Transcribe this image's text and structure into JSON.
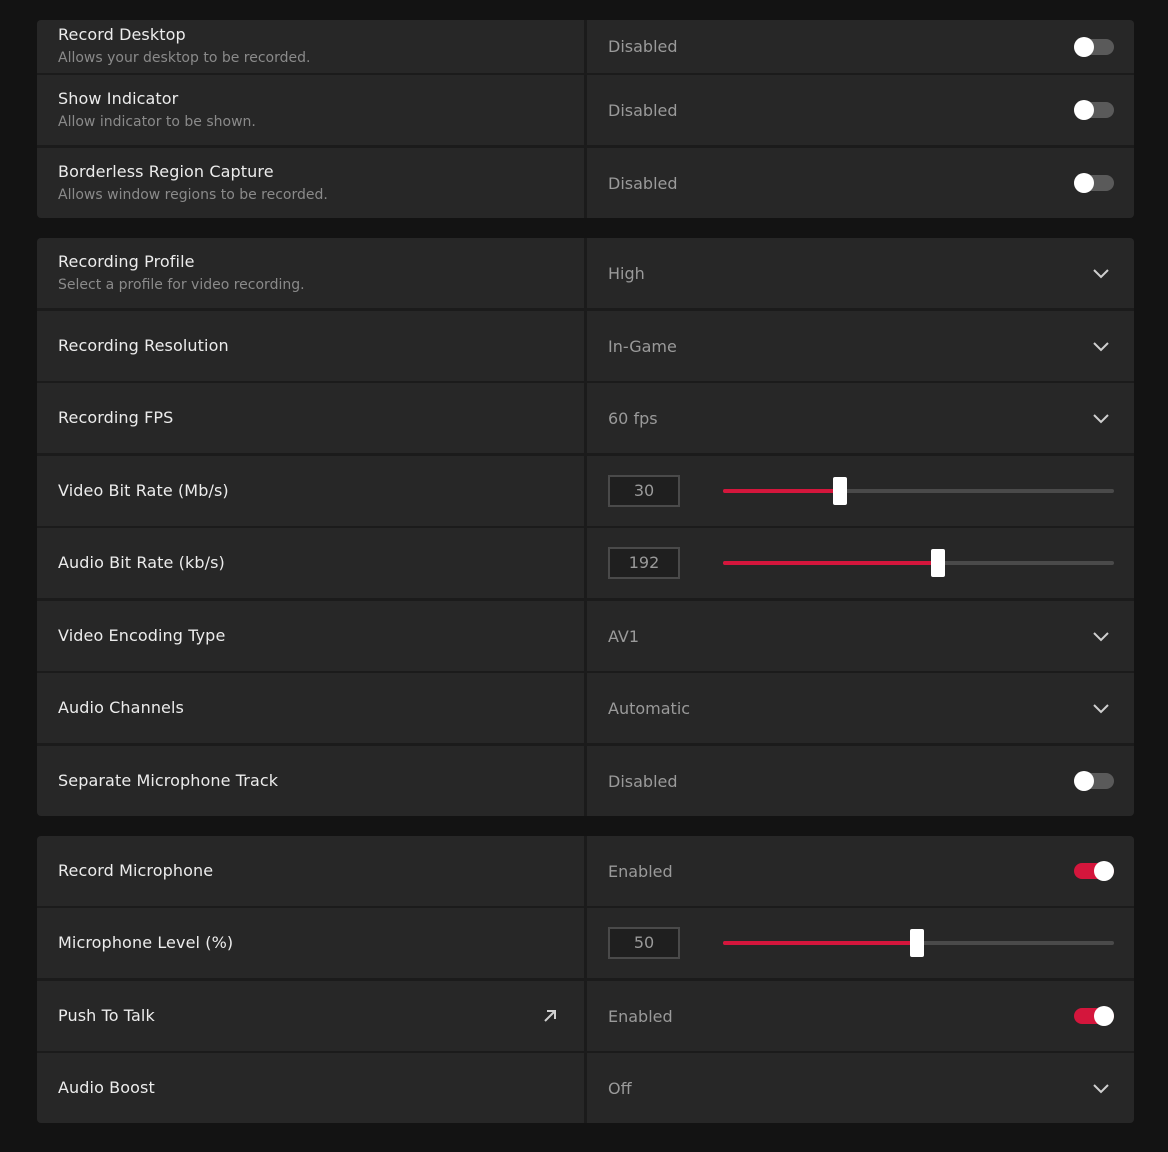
{
  "colors": {
    "accent": "#d4163c",
    "row_bg": "#272727",
    "page_bg": "#131313",
    "title_text": "#ececec",
    "subtext": "#8a8a8a",
    "value_text": "#9a9a9a"
  },
  "group1": {
    "record_desktop": {
      "title": "Record Desktop",
      "desc": "Allows your desktop to be recorded.",
      "value": "Disabled",
      "enabled": false
    },
    "show_indicator": {
      "title": "Show Indicator",
      "desc": "Allow indicator to be shown.",
      "value": "Disabled",
      "enabled": false
    },
    "borderless_capture": {
      "title": "Borderless Region Capture",
      "desc": "Allows window regions to be recorded.",
      "value": "Disabled",
      "enabled": false
    }
  },
  "group2": {
    "recording_profile": {
      "title": "Recording Profile",
      "desc": "Select a profile for video recording.",
      "value": "High",
      "icon": "chevron-down-icon"
    },
    "recording_resolution": {
      "title": "Recording Resolution",
      "value": "In-Game",
      "icon": "chevron-down-icon"
    },
    "recording_fps": {
      "title": "Recording FPS",
      "value": "60 fps",
      "icon": "chevron-down-icon"
    },
    "video_bitrate": {
      "title": "Video Bit Rate (Mb/s)",
      "value": "30",
      "level": 0.3
    },
    "audio_bitrate": {
      "title": "Audio Bit Rate (kb/s)",
      "value": "192",
      "level": 0.55
    },
    "video_encoding": {
      "title": "Video Encoding Type",
      "value": "AV1",
      "icon": "chevron-down-icon"
    },
    "audio_channels": {
      "title": "Audio Channels",
      "value": "Automatic",
      "icon": "chevron-down-icon"
    },
    "separate_mic_track": {
      "title": "Separate Microphone Track",
      "value": "Disabled",
      "enabled": false
    }
  },
  "group3": {
    "record_microphone": {
      "title": "Record Microphone",
      "value": "Enabled",
      "enabled": true
    },
    "microphone_level": {
      "title": "Microphone Level (%)",
      "value": "50",
      "level": 0.495
    },
    "push_to_talk": {
      "title": "Push To Talk",
      "value": "Enabled",
      "enabled": true,
      "icon": "external-link-icon"
    },
    "audio_boost": {
      "title": "Audio Boost",
      "value": "Off",
      "icon": "chevron-down-icon"
    }
  }
}
